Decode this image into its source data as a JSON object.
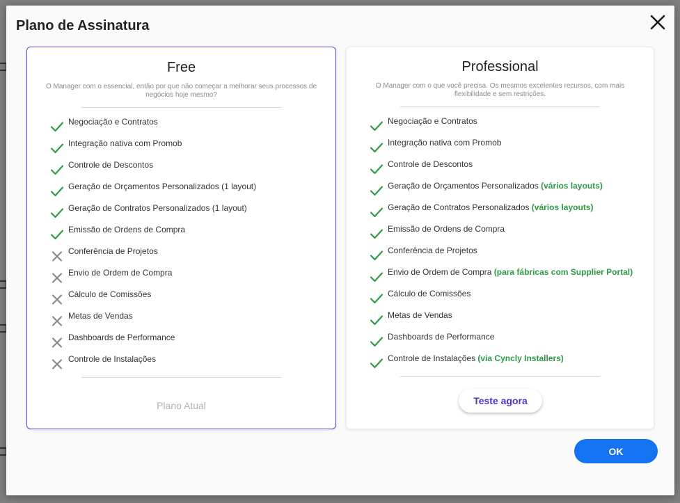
{
  "modal": {
    "title": "Plano de Assinatura",
    "ok_label": "OK"
  },
  "colors": {
    "accent": "#5b4ad8",
    "check": "#2e9b48",
    "cross": "#8a8a8a",
    "ok_button": "#1473f0"
  },
  "plans": {
    "free": {
      "title": "Free",
      "description": "O Manager com o essencial, então por que não começar a melhorar seus processos de negócios hoje mesmo?",
      "features": [
        {
          "label": "Negociação e Contratos",
          "included": true,
          "extra": ""
        },
        {
          "label": "Integração nativa com Promob",
          "included": true,
          "extra": ""
        },
        {
          "label": "Controle de Descontos",
          "included": true,
          "extra": ""
        },
        {
          "label": "Geração de Orçamentos Personalizados (1 layout)",
          "included": true,
          "extra": ""
        },
        {
          "label": "Geração de Contratos Personalizados (1 layout)",
          "included": true,
          "extra": ""
        },
        {
          "label": "Emissão de Ordens de Compra",
          "included": true,
          "extra": ""
        },
        {
          "label": "Conferência de Projetos",
          "included": false,
          "extra": ""
        },
        {
          "label": "Envio de Ordem de Compra",
          "included": false,
          "extra": ""
        },
        {
          "label": "Cálculo de Comissões",
          "included": false,
          "extra": ""
        },
        {
          "label": "Metas de Vendas",
          "included": false,
          "extra": ""
        },
        {
          "label": "Dashboards de Performance",
          "included": false,
          "extra": ""
        },
        {
          "label": "Controle de Instalações",
          "included": false,
          "extra": ""
        }
      ],
      "footer_label": "Plano Atual"
    },
    "professional": {
      "title": "Professional",
      "description": "O Manager com o que você precisa. Os mesmos excelentes recursos, com mais flexibilidade e sem restrições.",
      "features": [
        {
          "label": "Negociação e Contratos",
          "included": true,
          "extra": ""
        },
        {
          "label": "Integração nativa com Promob",
          "included": true,
          "extra": ""
        },
        {
          "label": "Controle de Descontos",
          "included": true,
          "extra": ""
        },
        {
          "label": "Geração de Orçamentos Personalizados",
          "included": true,
          "extra": "(vários layouts)"
        },
        {
          "label": "Geração de Contratos Personalizados",
          "included": true,
          "extra": "(vários layouts)"
        },
        {
          "label": "Emissão de Ordens de Compra",
          "included": true,
          "extra": ""
        },
        {
          "label": "Conferência de Projetos",
          "included": true,
          "extra": ""
        },
        {
          "label": "Envio de Ordem de Compra",
          "included": true,
          "extra": "(para fábricas com Supplier Portal)"
        },
        {
          "label": "Cálculo de Comissões",
          "included": true,
          "extra": ""
        },
        {
          "label": "Metas de Vendas",
          "included": true,
          "extra": ""
        },
        {
          "label": "Dashboards de Performance",
          "included": true,
          "extra": ""
        },
        {
          "label": "Controle de Instalações",
          "included": true,
          "extra": "(via Cyncly Installers)"
        }
      ],
      "button_label": "Teste agora"
    }
  }
}
